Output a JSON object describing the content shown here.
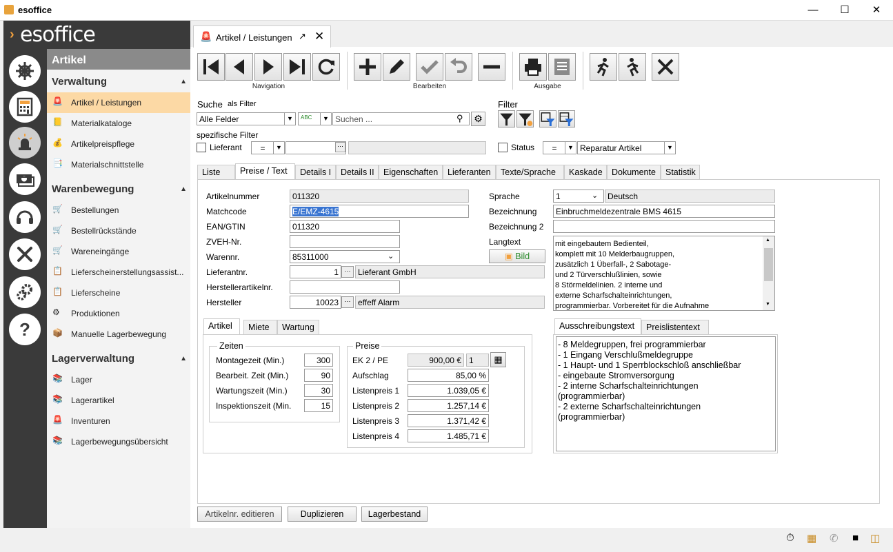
{
  "window": {
    "title": "esoffice"
  },
  "brand": "esoffice",
  "nav_icons": [
    "helm-icon",
    "calculator-icon",
    "alarm-light-icon",
    "money-icon",
    "headset-icon",
    "tools-icon",
    "gears-icon",
    "help-icon"
  ],
  "sidebar": {
    "header": "Artikel",
    "sections": [
      {
        "title": "Verwaltung",
        "items": [
          "Artikel / Leistungen",
          "Materialkataloge",
          "Artikelpreispflege",
          "Materialschnittstelle"
        ]
      },
      {
        "title": "Warenbewegung",
        "items": [
          "Bestellungen",
          "Bestellrückstände",
          "Wareneingänge",
          "Lieferscheinerstellungsassist...",
          "Lieferscheine",
          "Produktionen",
          "Manuelle Lagerbewegung"
        ]
      },
      {
        "title": "Lagerverwaltung",
        "items": [
          "Lager",
          "Lagerartikel",
          "Inventuren",
          "Lagerbewegungsübersicht"
        ]
      }
    ]
  },
  "doc_tab": {
    "label": "Artikel / Leistungen"
  },
  "toolbar": {
    "navigation": "Navigation",
    "bearbeiten": "Bearbeiten",
    "ausgabe": "Ausgabe"
  },
  "search": {
    "label": "Suche",
    "as_filter": "als Filter",
    "field": "Alle Felder",
    "placeholder": "Suchen ...",
    "spec_label": "spezifische Filter",
    "lieferant_label": "Lieferant",
    "op": "="
  },
  "filter": {
    "label": "Filter",
    "status_label": "Status",
    "op": "=",
    "value": "Reparatur Artikel"
  },
  "tabs": [
    "Liste",
    "Preise / Text",
    "Details I",
    "Details II",
    "Eigenschaften",
    "Lieferanten",
    "Texte/Sprache",
    "Kaskade",
    "Dokumente",
    "Statistik"
  ],
  "form": {
    "artikelnummer_label": "Artikelnummer",
    "artikelnummer": "011320",
    "matchcode_label": "Matchcode",
    "matchcode": "E/EMZ-4615",
    "ean_label": "EAN/GTIN",
    "ean": "011320",
    "zveh_label": "ZVEH-Nr.",
    "zveh": "",
    "warennr_label": "Warennr.",
    "warennr": "85311000",
    "lieferantnr_label": "Lieferantnr.",
    "lieferantnr": "1",
    "lieferant_name": "Lieferant GmbH",
    "herstartnr_label": "Herstellerartikelnr.",
    "herstartnr": "",
    "hersteller_label": "Hersteller",
    "hersteller_nr": "10023",
    "hersteller_name": "effeff Alarm",
    "sprache_label": "Sprache",
    "sprache_code": "1",
    "sprache": "Deutsch",
    "bezeichnung_label": "Bezeichnung",
    "bezeichnung": "Einbruchmeldezentrale BMS 4615",
    "bezeichnung2_label": "Bezeichnung 2",
    "bezeichnung2": "",
    "langtext_label": "Langtext",
    "bild_label": "Bild",
    "langtext_lines": [
      "mit eingebautem Bedienteil,",
      "komplett mit 10 Melderbaugruppen,",
      "zusätzlich 1 Überfall-, 2 Sabotage-",
      "und 2 Türverschlußlinien, sowie",
      "8 Störmeldelinien. 2 interne und",
      "externe Scharfschalteinrichtungen,",
      "programmierbar. Vorbereitet für die Aufnahme"
    ]
  },
  "subtabs": [
    "Artikel",
    "Miete",
    "Wartung"
  ],
  "zeiten": {
    "title": "Zeiten",
    "rows": [
      {
        "label": "Montagezeit (Min.)",
        "value": "300"
      },
      {
        "label": "Bearbeit. Zeit (Min.)",
        "value": "90"
      },
      {
        "label": "Wartungszeit (Min.)",
        "value": "30"
      },
      {
        "label": "Inspektionszeit (Min.",
        "value": "15"
      }
    ]
  },
  "preise": {
    "title": "Preise",
    "ek_label": "EK 2 / PE",
    "ek": "900,00 €",
    "pe": "1",
    "aufschlag_label": "Aufschlag",
    "aufschlag": "85,00 %",
    "rows": [
      {
        "label": "Listenpreis 1",
        "value": "1.039,05 €"
      },
      {
        "label": "Listenpreis 2",
        "value": "1.257,14 €"
      },
      {
        "label": "Listenpreis 3",
        "value": "1.371,42 €"
      },
      {
        "label": "Listenpreis 4",
        "value": "1.485,71 €"
      }
    ]
  },
  "texttabs": [
    "Ausschreibungstext",
    "Preislistentext"
  ],
  "ausschreibung_lines": [
    "- 8 Meldegruppen, frei programmierbar",
    "- 1 Eingang Verschlußmeldegruppe",
    "- 1 Haupt- und 1 Sperrblockschloß anschließbar",
    "- eingebaute Stromversorgung",
    "- 2 interne Scharfschalteinrichtungen",
    "(programmierbar)",
    "- 2 externe Scharfschalteinrichtungen",
    "(programmierbar)"
  ],
  "buttons": {
    "edit": "Artikelnr. editieren",
    "dup": "Duplizieren",
    "stock": "Lagerbestand"
  },
  "colors": {
    "accent": "#f2a03d",
    "active_item": "#fcd9a5",
    "selection": "#3874d1",
    "dark": "#3a3a3a"
  }
}
